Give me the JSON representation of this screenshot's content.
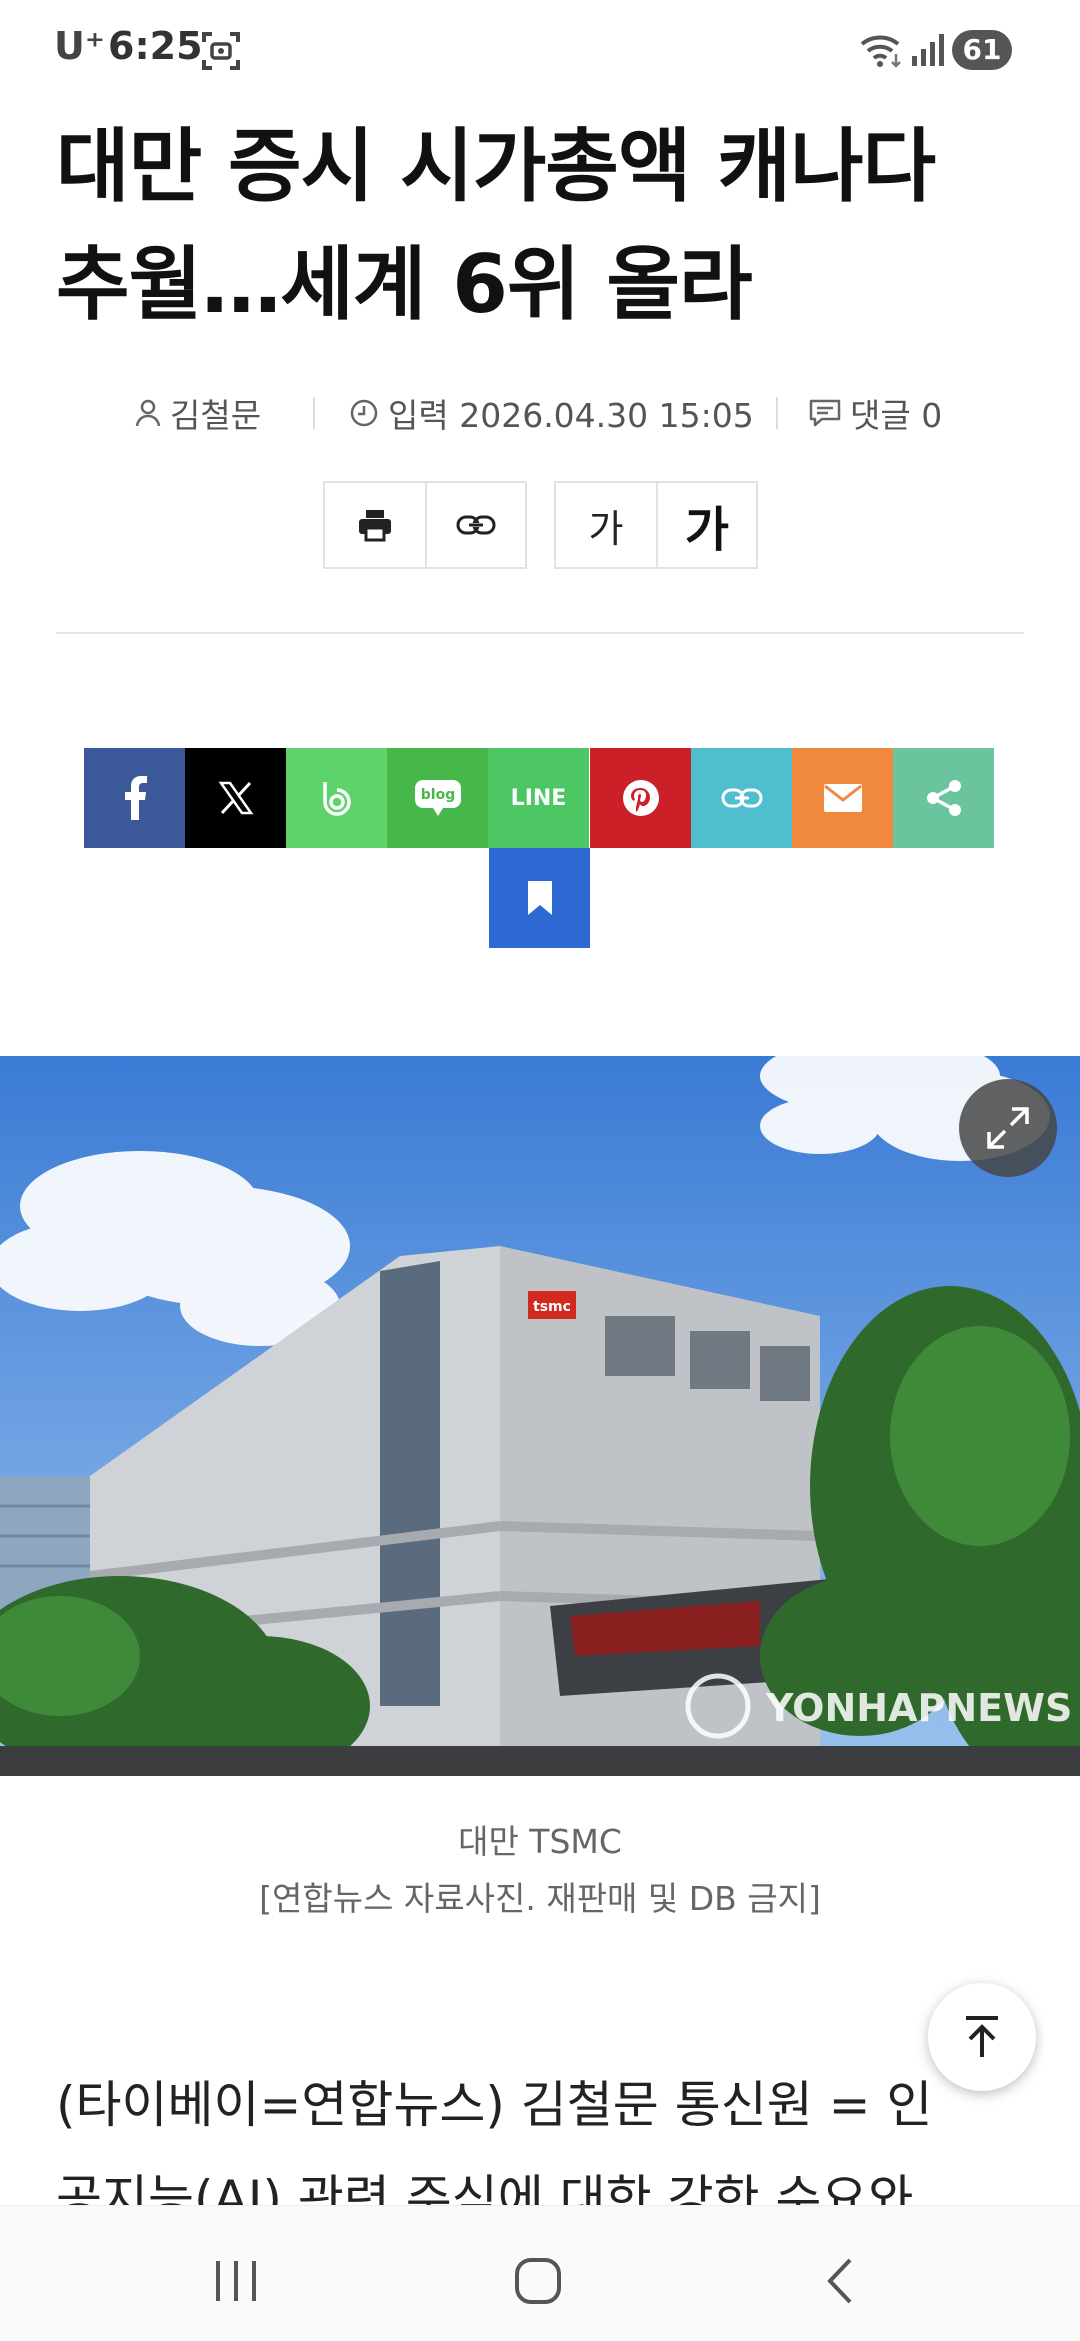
{
  "status_bar": {
    "carrier": "U⁺",
    "time": "6:25",
    "battery": "61",
    "icons": [
      "screenshot-icon",
      "wifi-icon",
      "signal-icon",
      "battery-icon"
    ]
  },
  "article": {
    "headline_line1": "대만 증시 시가총액 캐나다",
    "headline_line2": "추월…세계 6위 올라",
    "author": "김철문",
    "published": "입력 2026.04.30 15:05",
    "comments": "댓글 0",
    "photo_caption": "대만 TSMC",
    "photo_credit": "[연합뉴스 자료사진. 재판매 및 DB 금지]",
    "photo_watermark": "YONHAPNEWS",
    "photo_sign": "tsmc",
    "body_line1": "(타이베이=연합뉴스) 김철문 통신원 = 인",
    "body_line2": "공지능(AI) 관련 주식에 대한 강한 수요와"
  },
  "toolbar": {
    "font_small_label": "가",
    "font_large_label": "가",
    "icons": [
      "print-icon",
      "link-icon"
    ]
  },
  "share_buttons": [
    {
      "name": "facebook",
      "color": "#3b5998",
      "icon": "facebook-icon"
    },
    {
      "name": "x",
      "color": "#000000",
      "icon": "x-icon"
    },
    {
      "name": "band",
      "color": "#5fd36b",
      "icon": "band-icon"
    },
    {
      "name": "blog",
      "color": "#47b74a",
      "icon": "blog-icon",
      "label": "blog"
    },
    {
      "name": "line",
      "color": "#4cc764",
      "icon": "line-icon",
      "label": "LINE"
    },
    {
      "name": "pinterest",
      "color": "#cb2027",
      "icon": "pinterest-icon"
    },
    {
      "name": "copy-link",
      "color": "#4fbfd0",
      "icon": "link-icon"
    },
    {
      "name": "email",
      "color": "#f0883d",
      "icon": "mail-icon"
    },
    {
      "name": "share",
      "color": "#6ac49e",
      "icon": "share-icon"
    },
    {
      "name": "bookmark",
      "color": "#2d68d3",
      "icon": "bookmark-icon"
    }
  ],
  "navbar": {
    "icons": [
      "recent-apps-icon",
      "home-icon",
      "back-icon"
    ]
  }
}
